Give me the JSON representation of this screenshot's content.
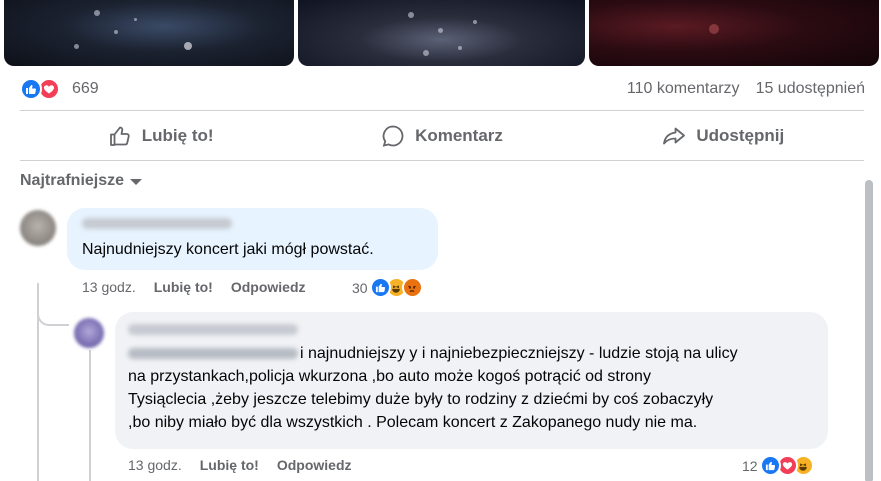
{
  "post": {
    "reaction_count": "669",
    "comments_count": "110 komentarzy",
    "shares_count": "15 udostępnień"
  },
  "actions": {
    "like": "Lubię to!",
    "comment": "Komentarz",
    "share": "Udostępnij"
  },
  "sort": {
    "label": "Najtrafniejsze"
  },
  "comments": [
    {
      "text": "Najnudniejszy koncert jaki mógł powstać.",
      "time": "13 godz.",
      "like": "Lubię to!",
      "reply": "Odpowiedz",
      "reaction_count": "30",
      "reactions": [
        "like-icon",
        "haha-icon",
        "angry-icon"
      ]
    },
    {
      "text_lines": [
        "i najnudniejszy y i najniebezpieczniejszy - ludzie stoją na ulicy",
        "na przystankach,policja wkurzona ,bo auto może kogoś potrącić od strony",
        "Tysiąclecia ,żeby jeszcze telebimy duże były to rodziny z dziećmi by coś zobaczyły",
        ",bo niby miało być dla wszystkich . Polecam koncert z Zakopanego nudy nie ma."
      ],
      "time": "13 godz.",
      "like": "Lubię to!",
      "reply": "Odpowiedz",
      "reaction_count": "12",
      "reactions": [
        "like-icon",
        "love-icon",
        "haha-icon"
      ]
    }
  ],
  "colors": {
    "accent": "#1877f2",
    "love": "#f33e58",
    "muted_text": "#65676b",
    "bubble": "#f0f2f5",
    "bubble_highlight": "#e7f3ff"
  }
}
